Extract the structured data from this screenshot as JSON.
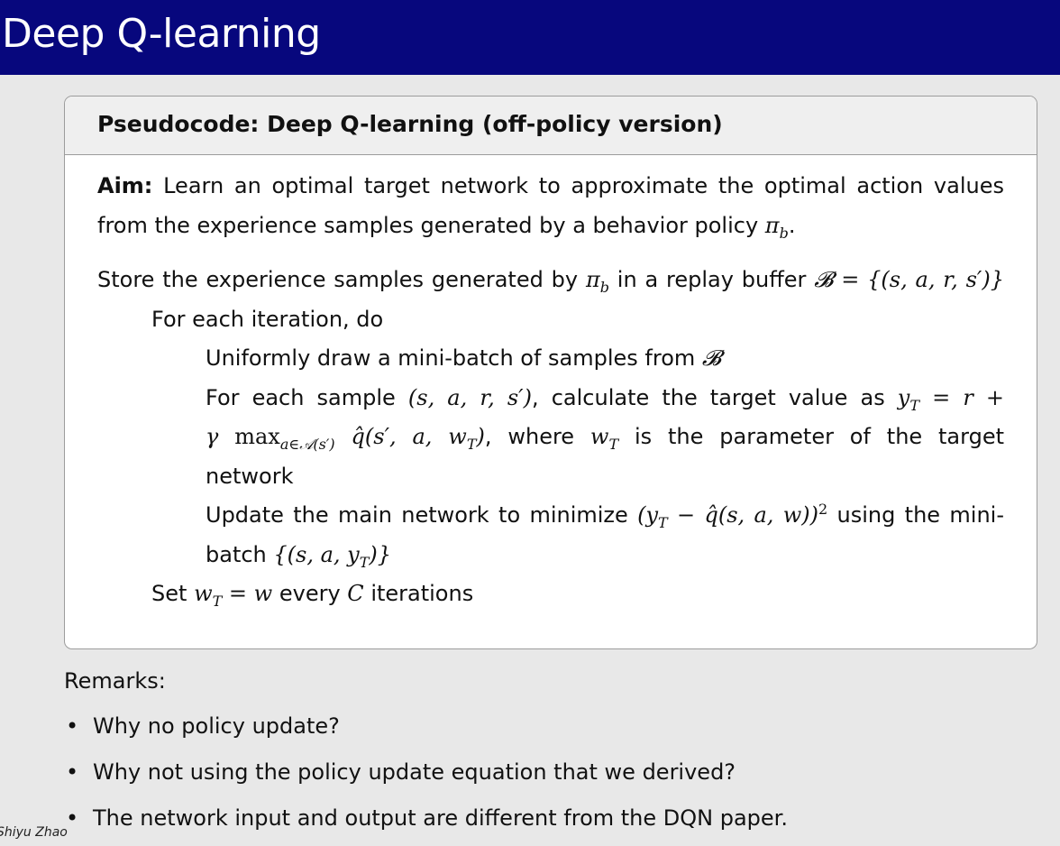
{
  "slide": {
    "title": "Deep Q-learning"
  },
  "pseudocode": {
    "heading": "Pseudocode: Deep Q-learning (off-policy version)",
    "aim_label": "Aim:",
    "aim_text_1": "Learn an optimal target network to approximate the optimal action values",
    "aim_text_2": "from the experience samples generated by a behavior policy",
    "line_store": "Store the experience samples generated by",
    "line_store_2": "in a replay buffer",
    "line_foreach_iter": "For each iteration, do",
    "line_draw": "Uniformly draw a mini-batch of samples from",
    "line_each_sample": "For each sample",
    "line_calc": ", calculate the target value as",
    "line_where": ", where",
    "line_param": "is the parameter of the target",
    "line_network": "network",
    "line_update": "Update the main network to minimize",
    "line_using": "using the mini-",
    "line_batch": "batch",
    "line_set": "Set",
    "line_every": "every",
    "line_iterations": "iterations"
  },
  "remarks": {
    "label": "Remarks:",
    "items": [
      "Why no policy update?",
      "Why not using the policy update equation that we derived?",
      "The network input and output are different from the DQN paper."
    ]
  },
  "footer": {
    "author": "Shiyu Zhao"
  }
}
